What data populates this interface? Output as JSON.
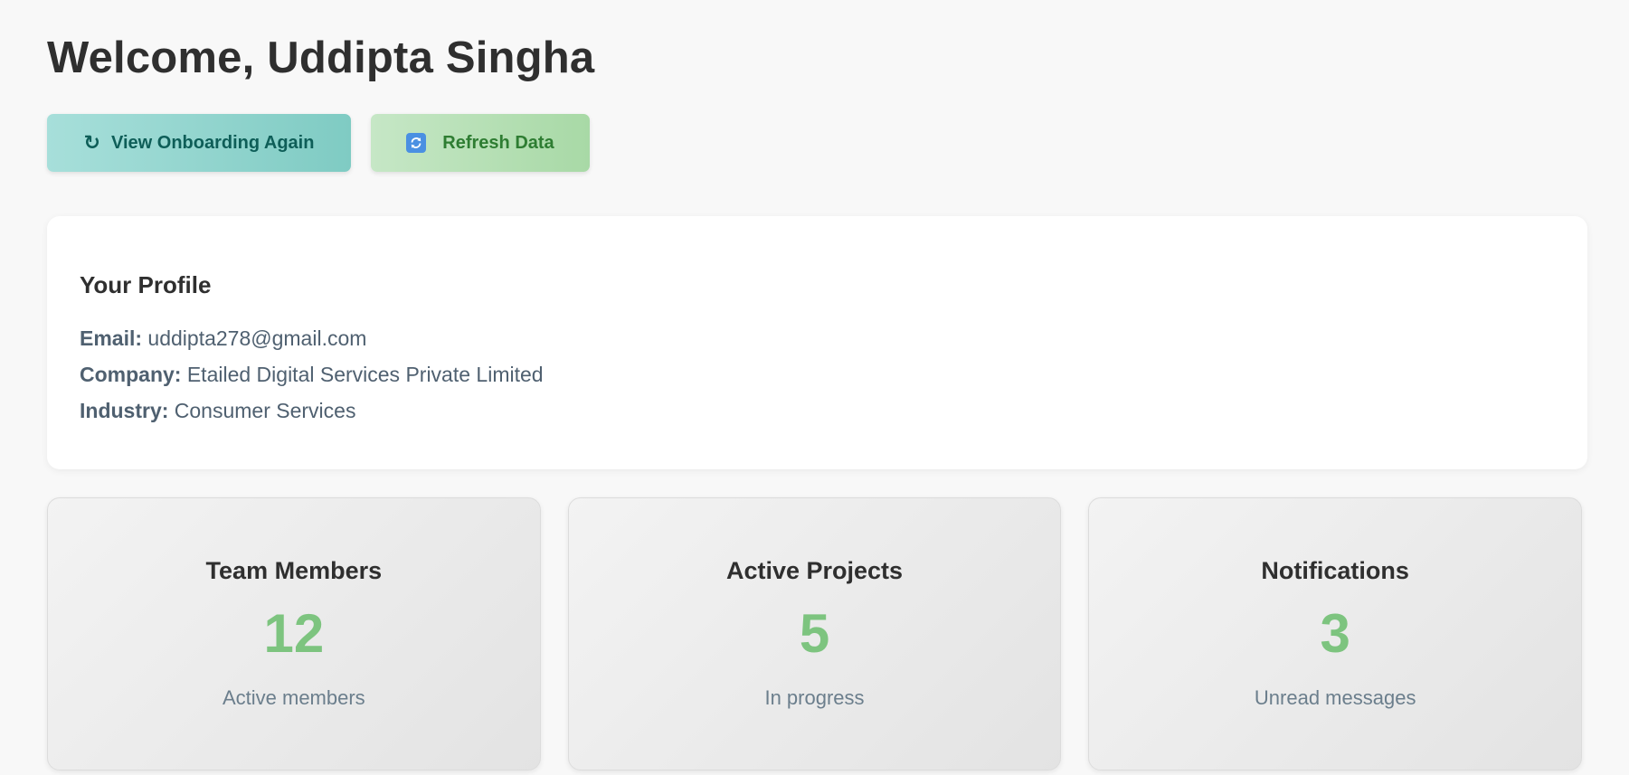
{
  "welcome": {
    "title": "Welcome, Uddipta Singha"
  },
  "actions": {
    "onboarding": {
      "icon_name": "reload-icon",
      "icon_glyph": "↻",
      "label": "View Onboarding Again"
    },
    "refresh": {
      "icon_name": "refresh-icon",
      "label": "Refresh Data"
    }
  },
  "profile": {
    "title": "Your Profile",
    "email_label": "Email:",
    "email_value": "uddipta278@gmail.com",
    "company_label": "Company:",
    "company_value": "Etailed Digital Services Private Limited",
    "industry_label": "Industry:",
    "industry_value": "Consumer Services"
  },
  "stats": [
    {
      "title": "Team Members",
      "value": "12",
      "subtitle": "Active members"
    },
    {
      "title": "Active Projects",
      "value": "5",
      "subtitle": "In progress"
    },
    {
      "title": "Notifications",
      "value": "3",
      "subtitle": "Unread messages"
    }
  ],
  "colors": {
    "background": "#f8f8f8",
    "stat_value": "#7dc47f",
    "onboarding_text": "#0e5e58",
    "refresh_text": "#2e7d32",
    "refresh_icon_bg": "#4a90e2"
  }
}
